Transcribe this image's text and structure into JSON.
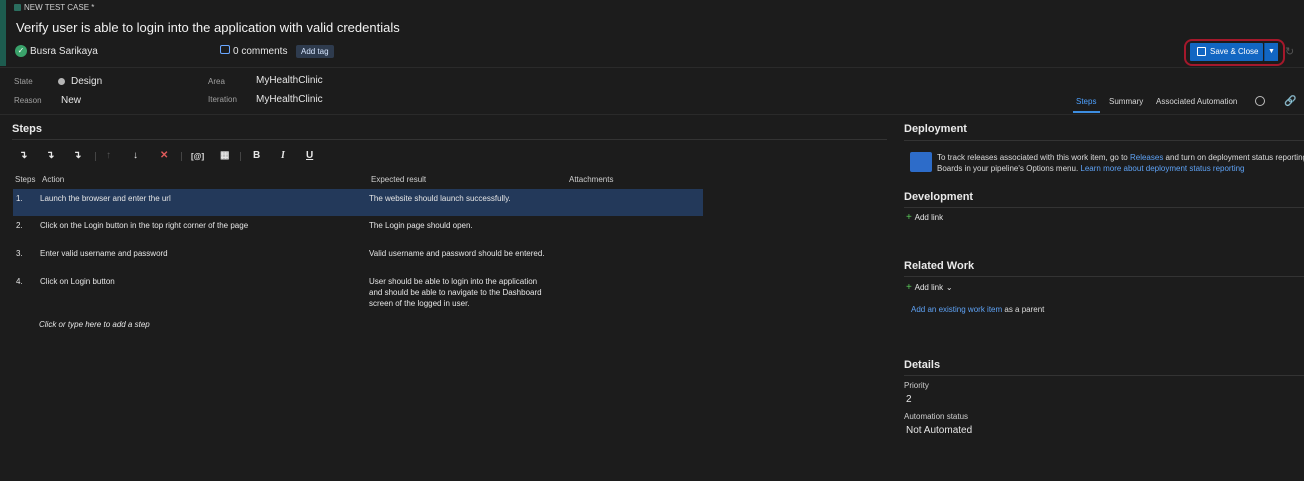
{
  "header": {
    "type_label": "NEW TEST CASE *",
    "title": "Verify user is able to login into the application with valid credentials",
    "user": "Busra Sarikaya",
    "comments": "0 comments",
    "add_tag": "Add tag",
    "save_close": "Save & Close"
  },
  "fields": {
    "state_label": "State",
    "state_value": "Design",
    "reason_label": "Reason",
    "reason_value": "New",
    "area_label": "Area",
    "area_value": "MyHealthClinic",
    "iteration_label": "Iteration",
    "iteration_value": "MyHealthClinic"
  },
  "tabs": [
    "Steps",
    "Summary",
    "Associated Automation"
  ],
  "steps": {
    "section_title": "Steps",
    "columns": [
      "Steps",
      "Action",
      "Expected result",
      "Attachments"
    ],
    "rows": [
      {
        "num": "1.",
        "action": "Launch the browser and enter the url",
        "expected": [
          "The website should launch successfully."
        ]
      },
      {
        "num": "2.",
        "action": "Click on the Login button in the top right corner of the page",
        "expected": [
          "The Login page should open."
        ]
      },
      {
        "num": "3.",
        "action": "Enter valid username and password",
        "expected": [
          "Valid username and password should be entered."
        ]
      },
      {
        "num": "4.",
        "action": "Click on Login button",
        "expected": [
          "User should be able to login into the application",
          "and should be able to navigate to the Dashboard",
          "screen of the logged in user."
        ]
      }
    ],
    "add_step": "Click or type here to add a step",
    "toolbar": {
      "bold": "B",
      "italic": "I",
      "underline": "U"
    }
  },
  "deployment": {
    "title": "Deployment",
    "text_1": "To track releases associated with this work item, go to ",
    "releases_link": "Releases",
    "text_2": " and turn on deployment status reporting",
    "text_3": "Boards in your pipeline's Options menu. ",
    "learn_more": "Learn more about deployment status reporting"
  },
  "development": {
    "title": "Development",
    "add_link": "Add link"
  },
  "related": {
    "title": "Related Work",
    "add_link": "Add link",
    "existing_link": "Add an existing work item",
    "existing_suffix": " as a parent"
  },
  "details": {
    "title": "Details",
    "priority_label": "Priority",
    "priority_value": "2",
    "automation_label": "Automation status",
    "automation_value": "Not Automated"
  },
  "colors": {
    "accent": "#1d5c4f",
    "save_button": "#1266c2",
    "highlight_border": "#a5182b",
    "selected_row": "#23395a"
  },
  "icons": [
    "comment-icon",
    "save-icon",
    "chevron-down-icon",
    "refresh-icon",
    "history-icon",
    "link-icon",
    "insert-step-icon",
    "insert-shared-steps-icon",
    "create-shared-steps-icon",
    "move-up-icon",
    "move-down-icon",
    "delete-icon",
    "parameter-icon",
    "attachment-icon",
    "pipelines-icon",
    "plus-icon"
  ]
}
